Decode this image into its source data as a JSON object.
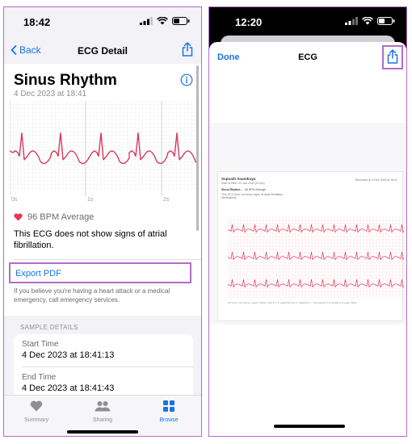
{
  "left": {
    "status": {
      "time": "18:42"
    },
    "nav": {
      "back_label": "Back",
      "title": "ECG Detail"
    },
    "ecg": {
      "title": "Sinus Rhythm",
      "date": "4 Dec 2023 at 18:41",
      "axis_ticks": [
        "0s",
        "1s",
        "2s"
      ],
      "bpm": "96 BPM Average",
      "description": "This ECG does not show signs of atrial fibrillation."
    },
    "export_label": "Export PDF",
    "warning": "If you believe you're having a heart attack or a medical emergency, call emergency services.",
    "sample_details": {
      "header": "SAMPLE DETAILS",
      "rows": [
        {
          "key": "Start Time",
          "value": "4 Dec 2023 at 18:41:13"
        },
        {
          "key": "End Time",
          "value": "4 Dec 2023 at 18:41:43"
        }
      ]
    },
    "tabs": [
      {
        "label": "Summary",
        "icon": "heart-icon",
        "active": false
      },
      {
        "label": "Sharing",
        "icon": "people-icon",
        "active": false
      },
      {
        "label": "Browse",
        "icon": "grid-icon",
        "active": true
      }
    ]
  },
  "right": {
    "status": {
      "time": "12:20"
    },
    "done_label": "Done",
    "title": "ECG",
    "pdf": {
      "name": "Supnath Anandraya",
      "date_line": "Date of Birth: 01 Jan 1990 (33 yrs)",
      "recorded": "Recorded on 4 Dec 2023 at 18:41",
      "rhythm_label": "Sinus Rhythm",
      "rhythm_detail": "— 96 BPM Average",
      "meds": "This ECG does not show signs of atrial fibrillation.",
      "medications": "Medications",
      "footer": "25 mm/s, 10 mm/mV, Lead I, 512Hz, iOS 17.1.1, watchOS 10.1.1, Watch6,4 — The waveform is similar to a Lead I ECG."
    }
  },
  "colors": {
    "accent": "#1a73e8",
    "highlight": "#b46cc8",
    "ecg_line": "#d9385c",
    "heart": "#e8345a"
  }
}
